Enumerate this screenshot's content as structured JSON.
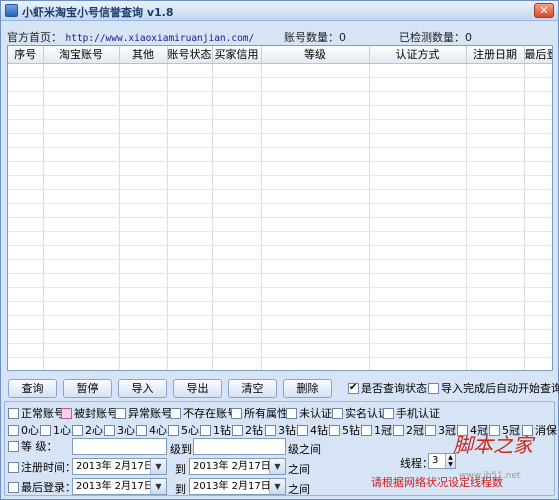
{
  "window": {
    "title": "小虾米淘宝小号信誉查询 v1.8",
    "close_label": "✕"
  },
  "info": {
    "homepage_label": "官方首页：",
    "homepage_url": "http://www.xiaoxiamiruanjian.com/",
    "account_count_label": "账号数量：",
    "account_count": "0",
    "checked_count_label": "已检测数量：",
    "checked_count": "0"
  },
  "table": {
    "columns": [
      "序号",
      "淘宝账号",
      "其他",
      "账号状态",
      "买家信用",
      "等级",
      "认证方式",
      "注册日期",
      "最后登陆"
    ],
    "row_count": 22
  },
  "buttons": {
    "query": "查询",
    "pause": "暂停",
    "import": "导入",
    "export": "导出",
    "clear": "清空",
    "delete": "删除"
  },
  "options": {
    "query_status": {
      "label": "是否查询状态",
      "checked": true
    },
    "auto_start": {
      "label": "导入完成后自动开始查询",
      "checked": false
    }
  },
  "filters": {
    "status_row": [
      "正常账号",
      "被封账号",
      "异常账号",
      "不存在账号",
      "所有属性",
      "未认证",
      "实名认证",
      "手机认证"
    ],
    "level_row": [
      "0心",
      "1心",
      "2心",
      "3心",
      "4心",
      "5心",
      "1钻",
      "2钻",
      "3钻",
      "4钻",
      "5钻",
      "1冠",
      "2冠",
      "3冠",
      "4冠",
      "5冠",
      "消保"
    ],
    "grade_label": "等    级：",
    "grade_to": "级到",
    "grade_between": "级之间",
    "reg_time_label": "注册时间：",
    "reg_from": "2013年 2月17日",
    "reg_to_word": "到",
    "reg_to": "2013年 2月17日",
    "reg_between": "之间",
    "last_login_label": "最后登录：",
    "login_from": "2013年 2月17日",
    "login_to_word": "到",
    "login_to": "2013年 2月17日",
    "login_between": "之间",
    "threads_label": "线程：",
    "threads_value": "3",
    "hint": "请根据网络状况设定线程数"
  },
  "watermark": {
    "text": "脚本之家",
    "url": "www.jb51.net"
  }
}
